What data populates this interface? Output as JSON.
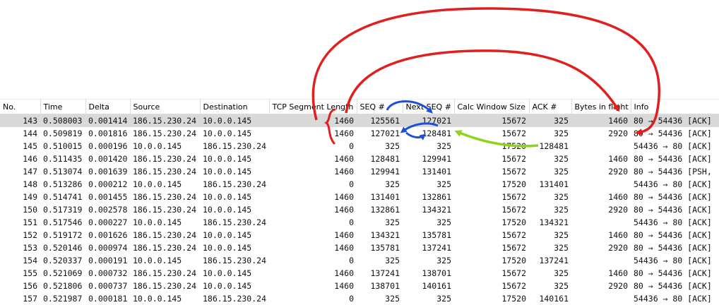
{
  "columns": [
    "No.",
    "Time",
    "Delta",
    "Source",
    "Destination",
    "TCP Segment Length",
    "SEQ #",
    "Next SEQ #",
    "Calc Window Size",
    "ACK #",
    "Bytes in flight",
    "Info"
  ],
  "colors": {
    "selected_row": "#d9d9d9",
    "arrow_red": "#e02020",
    "arrow_blue": "#1f4fd8",
    "arrow_green": "#8ed41f"
  },
  "rows": [
    {
      "no": "143",
      "time": "0.508003",
      "delta": "0.001414",
      "src": "186.15.230.24",
      "dst": "10.0.0.145",
      "len": "1460",
      "seq": "125561",
      "nseq": "127021",
      "win": "15672",
      "ack": "325",
      "bif": "1460",
      "info": "80 → 54436 [ACK]"
    },
    {
      "no": "144",
      "time": "0.509819",
      "delta": "0.001816",
      "src": "186.15.230.24",
      "dst": "10.0.0.145",
      "len": "1460",
      "seq": "127021",
      "nseq": "128481",
      "win": "15672",
      "ack": "325",
      "bif": "2920",
      "info": "80 → 54436 [ACK]"
    },
    {
      "no": "145",
      "time": "0.510015",
      "delta": "0.000196",
      "src": "10.0.0.145",
      "dst": "186.15.230.24",
      "len": "0",
      "seq": "325",
      "nseq": "325",
      "win": "17520",
      "ack": "128481",
      "bif": "",
      "info": "54436 → 80 [ACK]"
    },
    {
      "no": "146",
      "time": "0.511435",
      "delta": "0.001420",
      "src": "186.15.230.24",
      "dst": "10.0.0.145",
      "len": "1460",
      "seq": "128481",
      "nseq": "129941",
      "win": "15672",
      "ack": "325",
      "bif": "1460",
      "info": "80 → 54436 [ACK]"
    },
    {
      "no": "147",
      "time": "0.513074",
      "delta": "0.001639",
      "src": "186.15.230.24",
      "dst": "10.0.0.145",
      "len": "1460",
      "seq": "129941",
      "nseq": "131401",
      "win": "15672",
      "ack": "325",
      "bif": "2920",
      "info": "80 → 54436 [PSH,"
    },
    {
      "no": "148",
      "time": "0.513286",
      "delta": "0.000212",
      "src": "10.0.0.145",
      "dst": "186.15.230.24",
      "len": "0",
      "seq": "325",
      "nseq": "325",
      "win": "17520",
      "ack": "131401",
      "bif": "",
      "info": "54436 → 80 [ACK]"
    },
    {
      "no": "149",
      "time": "0.514741",
      "delta": "0.001455",
      "src": "186.15.230.24",
      "dst": "10.0.0.145",
      "len": "1460",
      "seq": "131401",
      "nseq": "132861",
      "win": "15672",
      "ack": "325",
      "bif": "1460",
      "info": "80 → 54436 [ACK]"
    },
    {
      "no": "150",
      "time": "0.517319",
      "delta": "0.002578",
      "src": "186.15.230.24",
      "dst": "10.0.0.145",
      "len": "1460",
      "seq": "132861",
      "nseq": "134321",
      "win": "15672",
      "ack": "325",
      "bif": "2920",
      "info": "80 → 54436 [ACK]"
    },
    {
      "no": "151",
      "time": "0.517546",
      "delta": "0.000227",
      "src": "10.0.0.145",
      "dst": "186.15.230.24",
      "len": "0",
      "seq": "325",
      "nseq": "325",
      "win": "17520",
      "ack": "134321",
      "bif": "",
      "info": "54436 → 80 [ACK]"
    },
    {
      "no": "152",
      "time": "0.519172",
      "delta": "0.001626",
      "src": "186.15.230.24",
      "dst": "10.0.0.145",
      "len": "1460",
      "seq": "134321",
      "nseq": "135781",
      "win": "15672",
      "ack": "325",
      "bif": "1460",
      "info": "80 → 54436 [ACK]"
    },
    {
      "no": "153",
      "time": "0.520146",
      "delta": "0.000974",
      "src": "186.15.230.24",
      "dst": "10.0.0.145",
      "len": "1460",
      "seq": "135781",
      "nseq": "137241",
      "win": "15672",
      "ack": "325",
      "bif": "2920",
      "info": "80 → 54436 [ACK]"
    },
    {
      "no": "154",
      "time": "0.520337",
      "delta": "0.000191",
      "src": "10.0.0.145",
      "dst": "186.15.230.24",
      "len": "0",
      "seq": "325",
      "nseq": "325",
      "win": "17520",
      "ack": "137241",
      "bif": "",
      "info": "54436 → 80 [ACK]"
    },
    {
      "no": "155",
      "time": "0.521069",
      "delta": "0.000732",
      "src": "186.15.230.24",
      "dst": "10.0.0.145",
      "len": "1460",
      "seq": "137241",
      "nseq": "138701",
      "win": "15672",
      "ack": "325",
      "bif": "1460",
      "info": "80 → 54436 [ACK]"
    },
    {
      "no": "156",
      "time": "0.521806",
      "delta": "0.000737",
      "src": "186.15.230.24",
      "dst": "10.0.0.145",
      "len": "1460",
      "seq": "138701",
      "nseq": "140161",
      "win": "15672",
      "ack": "325",
      "bif": "2920",
      "info": "80 → 54436 [ACK]"
    },
    {
      "no": "157",
      "time": "0.521987",
      "delta": "0.000181",
      "src": "10.0.0.145",
      "dst": "186.15.230.24",
      "len": "0",
      "seq": "325",
      "nseq": "325",
      "win": "17520",
      "ack": "140161",
      "bif": "",
      "info": "54436 → 80 [ACK]"
    }
  ],
  "selected_row": 0
}
